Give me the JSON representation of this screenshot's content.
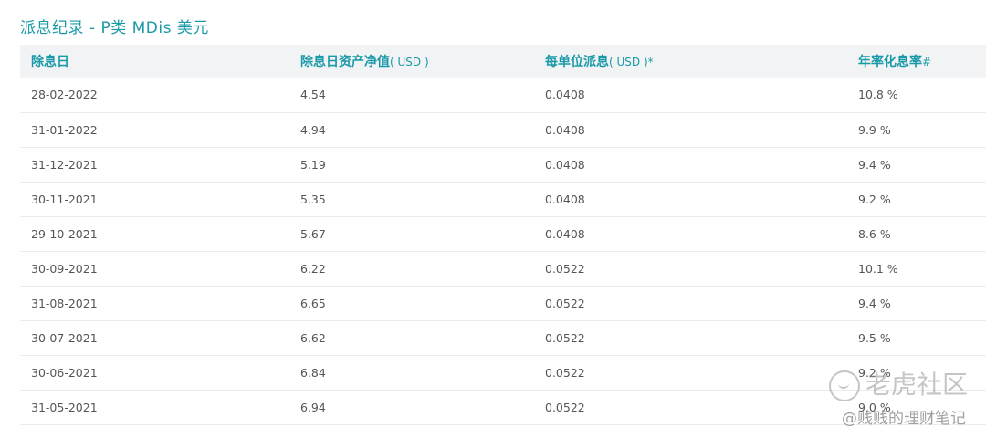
{
  "page_title": "派息纪录 - P类 MDis 美元",
  "columns": [
    {
      "label": "除息日",
      "unit": ""
    },
    {
      "label": "除息日资产净值",
      "unit": "( USD )"
    },
    {
      "label": "每单位派息",
      "unit": "( USD )*"
    },
    {
      "label": "年率化息率",
      "unit": "#"
    }
  ],
  "rows": [
    [
      "28-02-2022",
      "4.54",
      "0.0408",
      "10.8 %"
    ],
    [
      "31-01-2022",
      "4.94",
      "0.0408",
      "9.9 %"
    ],
    [
      "31-12-2021",
      "5.19",
      "0.0408",
      "9.4 %"
    ],
    [
      "30-11-2021",
      "5.35",
      "0.0408",
      "9.2 %"
    ],
    [
      "29-10-2021",
      "5.67",
      "0.0408",
      "8.6 %"
    ],
    [
      "30-09-2021",
      "6.22",
      "0.0522",
      "10.1 %"
    ],
    [
      "31-08-2021",
      "6.65",
      "0.0522",
      "9.4 %"
    ],
    [
      "30-07-2021",
      "6.62",
      "0.0522",
      "9.5 %"
    ],
    [
      "30-06-2021",
      "6.84",
      "0.0522",
      "9.2 %"
    ],
    [
      "31-05-2021",
      "6.94",
      "0.0522",
      "9.0 %"
    ]
  ],
  "watermark": {
    "brand": "老虎社区",
    "author": "@贱贱的理财笔记"
  }
}
